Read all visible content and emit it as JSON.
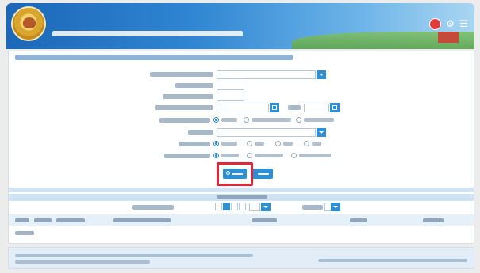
{
  "header": {
    "title": "",
    "subtitle": ""
  },
  "icons": {
    "logo": "department-emblem-icon",
    "notification": "bell-icon",
    "settings": "gear-icon",
    "menu": "menu-icon",
    "search": "search-icon",
    "clear": "clear-icon",
    "dropdown": "chevron-down-icon",
    "calendar": "calendar-icon"
  },
  "breadcrumb": "",
  "form": {
    "fields": [
      {
        "label": "",
        "value": ""
      },
      {
        "label": "",
        "value": ""
      },
      {
        "label": "",
        "value": ""
      },
      {
        "label": "",
        "value": ""
      },
      {
        "label": "",
        "value": ""
      },
      {
        "label": "",
        "value": ""
      }
    ],
    "radio_group_1": {
      "label": "",
      "options": [
        "",
        "",
        ""
      ]
    },
    "radio_group_2": {
      "label": "",
      "options": [
        "",
        "",
        "",
        ""
      ]
    },
    "radio_group_3": {
      "label": "",
      "options": [
        "",
        "",
        ""
      ]
    }
  },
  "buttons": {
    "search_label": "",
    "clear_label": ""
  },
  "results": {
    "title": "",
    "pager_label": "",
    "page_size": "",
    "columns": [
      "",
      "",
      "",
      "",
      "",
      "",
      ""
    ],
    "empty_text": ""
  },
  "footer": {
    "line1": "",
    "line2": "",
    "right": ""
  },
  "colors": {
    "header_blue": "#1b67b8",
    "accent": "#2d8fd5",
    "highlight": "#e0263a"
  }
}
